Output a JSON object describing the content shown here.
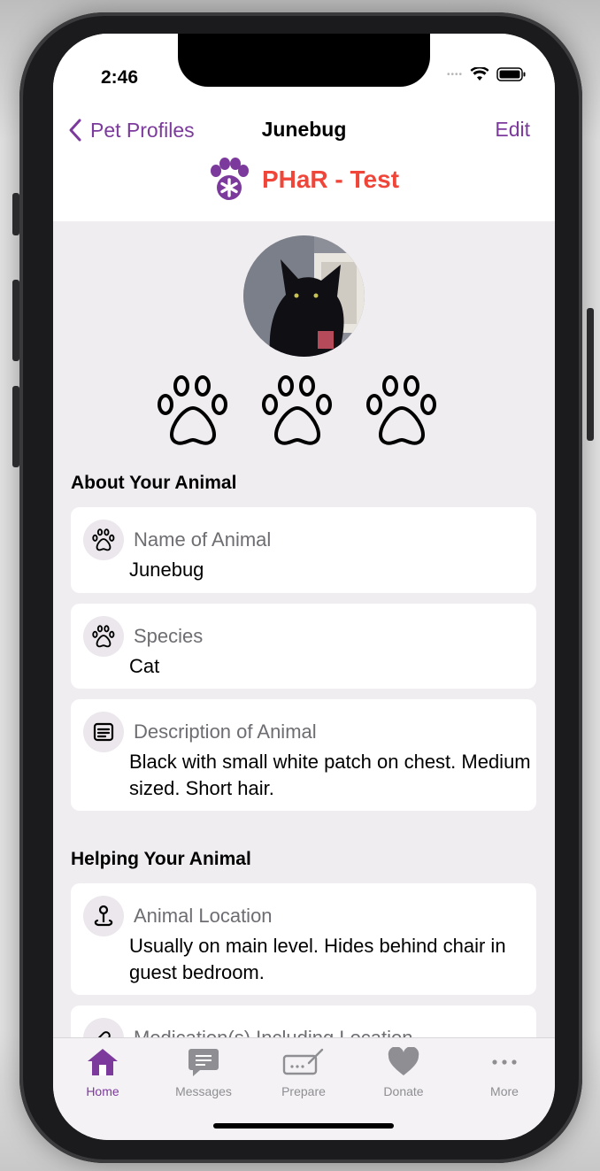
{
  "status": {
    "time": "2:46"
  },
  "nav": {
    "back_label": "Pet Profiles",
    "title": "Junebug",
    "edit_label": "Edit"
  },
  "brand": {
    "name": "PHaR - Test"
  },
  "sections": {
    "about": "About Your Animal",
    "helping": "Helping Your Animal"
  },
  "fields": [
    {
      "label": "Name of Animal",
      "value": "Junebug",
      "icon": "paw-icon"
    },
    {
      "label": "Species",
      "value": "Cat",
      "icon": "paw-icon"
    },
    {
      "label": "Description of Animal",
      "value": "Black with small white patch on chest. Medium sized. Short hair.",
      "icon": "document-icon"
    },
    {
      "label": "Animal Location",
      "value": "Usually on main level. Hides behind chair in guest bedroom.",
      "icon": "location-pin-icon"
    },
    {
      "label": "Medication(s) Including Location",
      "value": "",
      "icon": "medication-icon"
    }
  ],
  "tabs": [
    {
      "label": "Home",
      "icon": "home-icon",
      "active": true
    },
    {
      "label": "Messages",
      "icon": "message-icon",
      "active": false
    },
    {
      "label": "Prepare",
      "icon": "prepare-icon",
      "active": false
    },
    {
      "label": "Donate",
      "icon": "heart-icon",
      "active": false
    },
    {
      "label": "More",
      "icon": "more-icon",
      "active": false
    }
  ],
  "colors": {
    "accent": "#7b3a9c",
    "brand_red": "#f0463a",
    "background": "#f0edf0"
  }
}
